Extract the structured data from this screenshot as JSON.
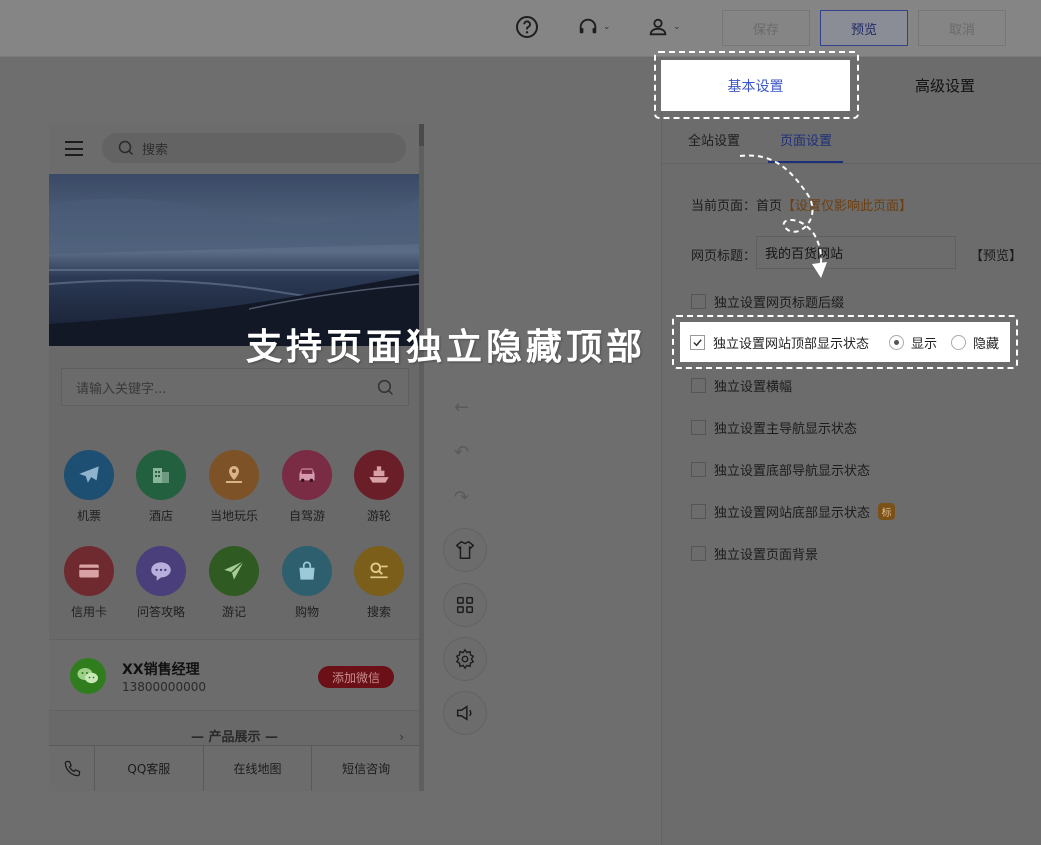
{
  "topbar": {
    "icons": [
      "help-icon",
      "headset-icon",
      "user-icon"
    ],
    "save_label": "保存",
    "preview_label": "预览",
    "cancel_label": "取消"
  },
  "phone": {
    "search_placeholder": "搜索",
    "search2_placeholder": "请输入关键字...",
    "grid": [
      {
        "label": "机票",
        "icon": "plane-icon",
        "color": "#1d4f72"
      },
      {
        "label": "酒店",
        "icon": "hotel-icon",
        "color": "#23603f"
      },
      {
        "label": "当地玩乐",
        "icon": "map-pin-icon",
        "color": "#7d5226"
      },
      {
        "label": "自驾游",
        "icon": "car-icon",
        "color": "#7a2c45"
      },
      {
        "label": "游轮",
        "icon": "ship-icon",
        "color": "#6a1f28"
      },
      {
        "label": "信用卡",
        "icon": "card-icon",
        "color": "#6e2a2e"
      },
      {
        "label": "问答攻略",
        "icon": "chat-icon",
        "color": "#4a3f7a"
      },
      {
        "label": "游记",
        "icon": "paper-plane-icon",
        "color": "#2f5a22"
      },
      {
        "label": "购物",
        "icon": "shopping-bag-icon",
        "color": "#2e5f6e"
      },
      {
        "label": "搜索",
        "icon": "search-list-icon",
        "color": "#7a5e1a"
      }
    ],
    "contact": {
      "name": "XX销售经理",
      "phone": "13800000000",
      "add_wechat": "添加微信"
    },
    "products_title": "— 产品展示 —",
    "bottom_bar": [
      "QQ客服",
      "在线地图",
      "短信咨询"
    ]
  },
  "tools": [
    "shirt-icon",
    "grid-icon",
    "gear-icon",
    "speaker-icon"
  ],
  "panel": {
    "tab_basic": "基本设置",
    "tab_advanced": "高级设置",
    "subtab_site": "全站设置",
    "subtab_page": "页面设置",
    "current_page_label": "当前页面：首页",
    "current_page_note": "【设置仅影响此页面】",
    "title_label": "网页标题：",
    "title_value": "我的百货网站",
    "title_preview": "【预览】",
    "options": [
      {
        "label": "独立设置网页标题后缀",
        "checked": false
      },
      {
        "label": "独立设置网站顶部显示状态",
        "checked": true
      },
      {
        "label": "独立设置横幅",
        "checked": false
      },
      {
        "label": "独立设置主导航显示状态",
        "checked": false
      },
      {
        "label": "独立设置底部导航显示状态",
        "checked": false
      },
      {
        "label": "独立设置网站底部显示状态",
        "checked": false
      },
      {
        "label": "独立设置页面背景",
        "checked": false
      }
    ],
    "radio_show": "显示",
    "radio_hide": "隐藏",
    "badge": "标"
  },
  "caption": "支持页面独立隐藏顶部"
}
